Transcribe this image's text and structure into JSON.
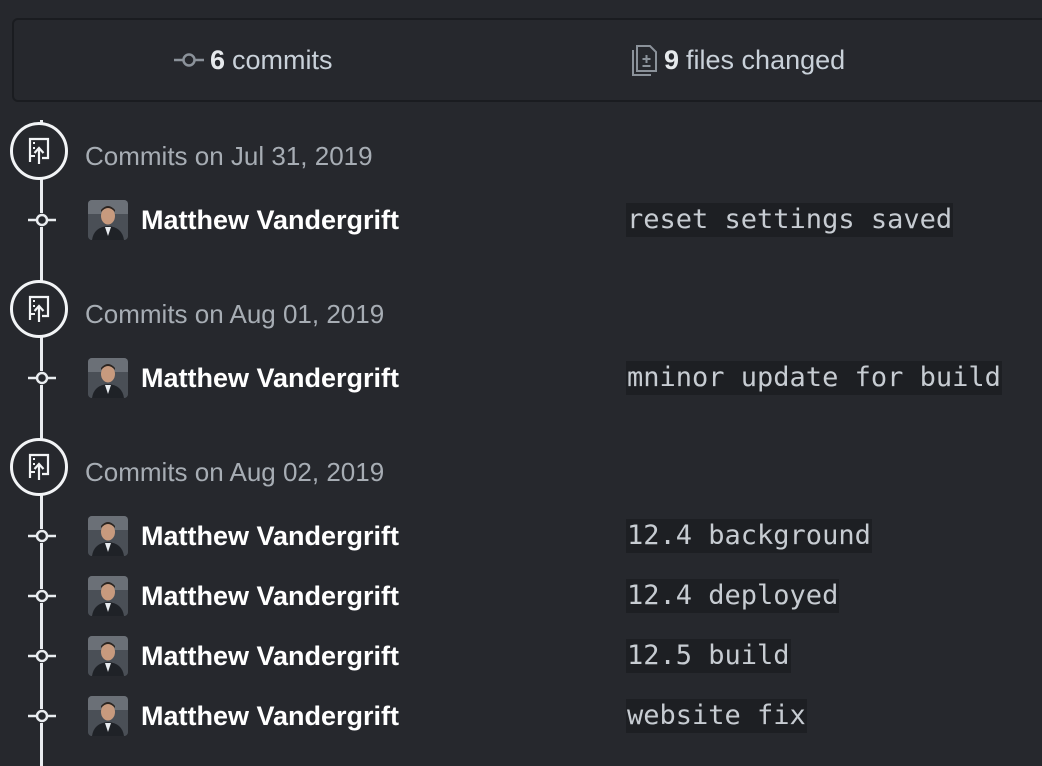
{
  "summary": {
    "commits_count": "6",
    "commits_label": "commits",
    "files_count": "9",
    "files_label": "files changed"
  },
  "days": [
    {
      "title": "Commits on Jul 31, 2019",
      "commits": [
        {
          "author": "Matthew Vandergrift",
          "message": "reset settings saved"
        }
      ]
    },
    {
      "title": "Commits on Aug 01, 2019",
      "commits": [
        {
          "author": "Matthew Vandergrift",
          "message": "mninor update for build"
        }
      ]
    },
    {
      "title": "Commits on Aug 02, 2019",
      "commits": [
        {
          "author": "Matthew Vandergrift",
          "message": "12.4 background"
        },
        {
          "author": "Matthew Vandergrift",
          "message": "12.4 deployed"
        },
        {
          "author": "Matthew Vandergrift",
          "message": "12.5 build"
        },
        {
          "author": "Matthew Vandergrift",
          "message": "website fix"
        }
      ]
    }
  ],
  "icons": {
    "commits": "git-commit-icon",
    "files": "file-diff-icon",
    "day": "repo-push-icon",
    "node": "commit-node-icon"
  },
  "colors": {
    "background": "#26282d",
    "text_muted": "#a7adb4",
    "text_strong": "#ffffff",
    "code_bg": "#1d1f23"
  }
}
